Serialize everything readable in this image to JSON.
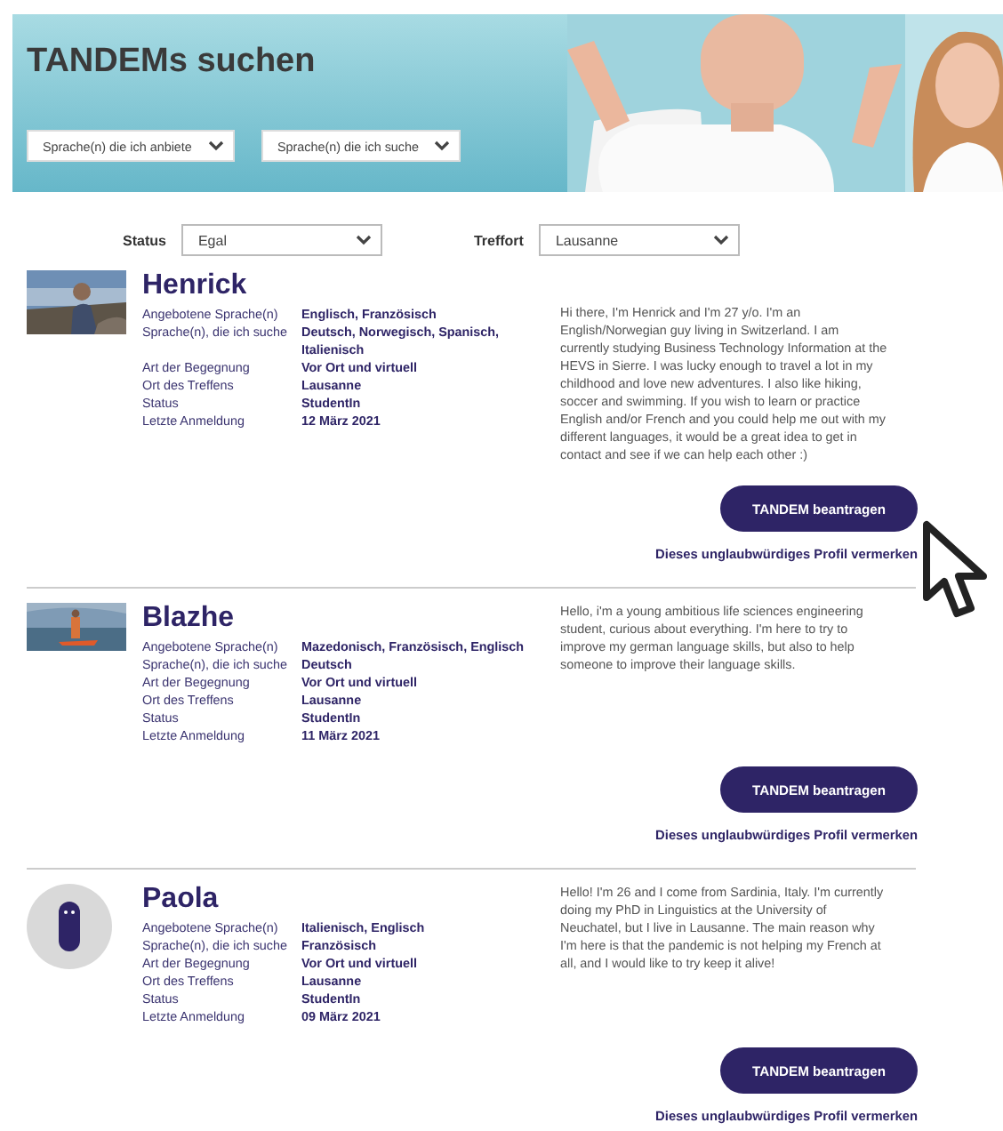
{
  "header": {
    "title": "TANDEMs suchen",
    "dropdowns": [
      {
        "value": "Sprache(n) die ich anbiete"
      },
      {
        "value": "Sprache(n) die ich suche"
      }
    ]
  },
  "filters": [
    {
      "label": "Status",
      "value": "Egal"
    },
    {
      "label": "Treffort",
      "value": "Lausanne"
    }
  ],
  "profiles": [
    {
      "name": "Henrick",
      "details": [
        {
          "label": "Angebotene Sprache(n)",
          "value": "Englisch, Französisch"
        },
        {
          "label": "Sprache(n), die ich suche",
          "value": "Deutsch, Norwegisch, Spanisch, Italienisch"
        },
        {
          "label": "Art der Begegnung",
          "value": "Vor Ort und virtuell"
        },
        {
          "label": "Ort des Treffens",
          "value": "Lausanne"
        },
        {
          "label": "Status",
          "value": "StudentIn"
        },
        {
          "label": "Letzte Anmeldung",
          "value": "12 März 2021"
        }
      ],
      "bio": "Hi there, I'm Henrick and I'm 27 y/o. I'm an English/Norwegian guy living in Switzerland. I am currently studying Business Technology Information at the HEVS in Sierre. I was lucky enough to travel a lot in my childhood and love new adventures. I also like hiking, soccer and swimming. If you wish to learn or practice English and/or French and you could help me out with my different languages, it would be a great idea to get in contact and see if we can help each other :)",
      "button": "TANDEM beantragen",
      "report_link": "Dieses unglaubwürdiges Profil vermerken"
    },
    {
      "name": "Blazhe",
      "details": [
        {
          "label": "Angebotene Sprache(n)",
          "value": "Mazedonisch, Französisch, Englisch"
        },
        {
          "label": "Sprache(n), die ich suche",
          "value": "Deutsch"
        },
        {
          "label": "Art der Begegnung",
          "value": "Vor Ort und virtuell"
        },
        {
          "label": "Ort des Treffens",
          "value": "Lausanne"
        },
        {
          "label": "Status",
          "value": "StudentIn"
        },
        {
          "label": "Letzte Anmeldung",
          "value": "11 März 2021"
        }
      ],
      "bio": "Hello, i'm a young ambitious life sciences engineering student, curious about everything. I'm here to try to improve my german language skills, but also to help someone to improve their language skills.",
      "button": "TANDEM beantragen",
      "report_link": "Dieses unglaubwürdiges Profil vermerken"
    },
    {
      "name": "Paola",
      "avatar": {
        "kind": "default"
      },
      "details": [
        {
          "label": "Angebotene Sprache(n)",
          "value": "Italienisch, Englisch"
        },
        {
          "label": "Sprache(n), die ich suche",
          "value": "Französisch"
        },
        {
          "label": "Art der Begegnung",
          "value": "Vor Ort und virtuell"
        },
        {
          "label": "Ort des Treffens",
          "value": "Lausanne"
        },
        {
          "label": "Status",
          "value": "StudentIn"
        },
        {
          "label": "Letzte Anmeldung",
          "value": "09 März 2021"
        }
      ],
      "bio": "Hello! I'm 26 and I come from Sardinia, Italy. I'm currently doing my PhD in Linguistics at the University of Neuchatel, but I live in Lausanne. The main reason why I'm here is that the pandemic is not helping my French at all, and I would like to try keep it alive!",
      "button": "TANDEM beantragen",
      "report_link": "Dieses unglaubwürdiges Profil vermerken"
    }
  ]
}
